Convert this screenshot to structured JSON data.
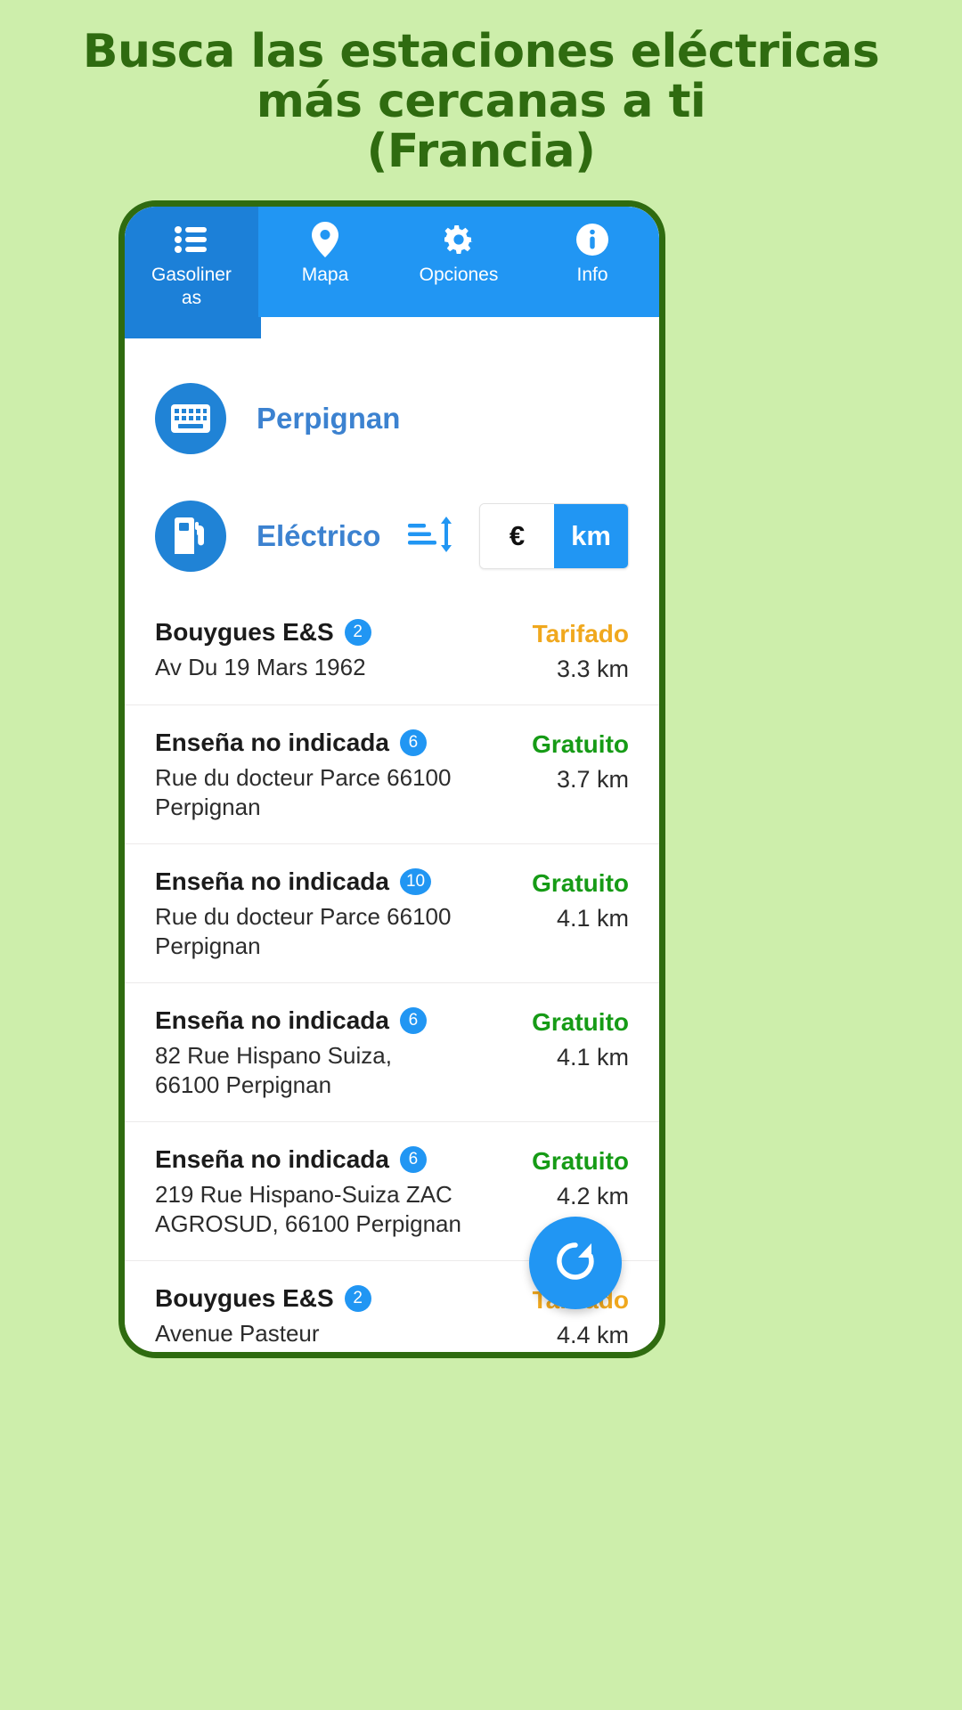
{
  "headline": {
    "line1": "Busca las estaciones eléctricas",
    "line2": "más cercanas a ti",
    "line3": "(Francia)"
  },
  "colors": {
    "background": "#cdeeab",
    "headline_text": "#2f6b10",
    "frame_border": "#2f6b10",
    "accent_blue": "#2196f3",
    "tab_selected_blue": "#1c80d8",
    "link_blue": "#3c82d0",
    "status_tarifado": "#f0a81e",
    "status_gratuito": "#169b16"
  },
  "tabs": [
    {
      "label": "Gasolineras",
      "icon": "list-icon",
      "selected": true
    },
    {
      "label": "Mapa",
      "icon": "map-pin-icon",
      "selected": false
    },
    {
      "label": "Opciones",
      "icon": "gear-icon",
      "selected": false
    },
    {
      "label": "Info",
      "icon": "info-icon",
      "selected": false
    }
  ],
  "filters": {
    "city": {
      "icon": "keyboard-icon",
      "value": "Perpignan"
    },
    "fuel": {
      "icon": "fuel-pump-icon",
      "value": "Eléctrico"
    },
    "sort_icon": "sort-icon",
    "units": {
      "options": [
        "€",
        "km"
      ],
      "selected": "km"
    }
  },
  "stations": [
    {
      "name": "Bouygues E&S",
      "badge": "2",
      "address": "Av Du 19 Mars 1962",
      "status": "Tarifado",
      "status_kind": "tarifado",
      "distance": "3.3 km"
    },
    {
      "name": "Enseña no indicada",
      "badge": "6",
      "address": "Rue du docteur Parce 66100 Perpignan",
      "status": "Gratuito",
      "status_kind": "gratuito",
      "distance": "3.7 km"
    },
    {
      "name": "Enseña no indicada",
      "badge": "10",
      "address": "Rue du docteur Parce 66100 Perpignan",
      "status": "Gratuito",
      "status_kind": "gratuito",
      "distance": "4.1 km"
    },
    {
      "name": "Enseña no indicada",
      "badge": "6",
      "address": "82 Rue Hispano Suiza, 66100 Perpignan",
      "status": "Gratuito",
      "status_kind": "gratuito",
      "distance": "4.1 km"
    },
    {
      "name": "Enseña no indicada",
      "badge": "6",
      "address": "219 Rue Hispano-Suiza ZAC AGROSUD, 66100 Perpignan",
      "status": "Gratuito",
      "status_kind": "gratuito",
      "distance": "4.2 km"
    },
    {
      "name": "Bouygues E&S",
      "badge": "2",
      "address": "Avenue Pasteur",
      "status": "Tarifado",
      "status_kind": "tarifado",
      "distance": "4.4 km"
    }
  ],
  "fab": {
    "icon": "refresh-icon"
  }
}
